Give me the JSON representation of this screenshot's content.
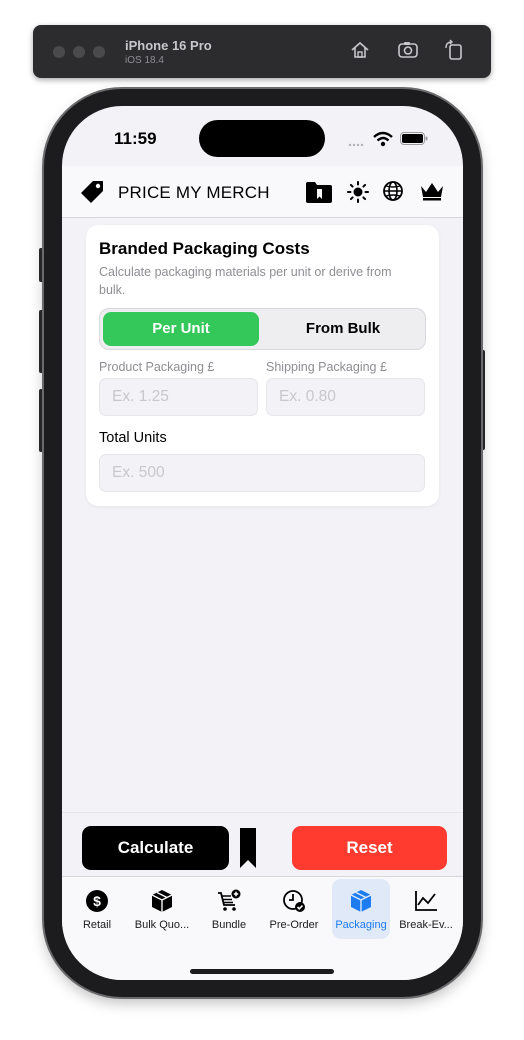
{
  "simulator": {
    "device": "iPhone 16 Pro",
    "os": "iOS 18.4"
  },
  "status_bar": {
    "time": "11:59"
  },
  "header": {
    "title": "PRICE MY MERCH"
  },
  "card": {
    "title": "Branded Packaging Costs",
    "subtitle": "Calculate packaging materials per unit or derive from bulk.",
    "segments": {
      "selected": "Per Unit",
      "other": "From Bulk"
    },
    "product_label": "Product Packaging £",
    "product_placeholder": "Ex. 1.25",
    "shipping_label": "Shipping Packaging £",
    "shipping_placeholder": "Ex. 0.80",
    "units_label": "Total Units",
    "units_placeholder": "Ex. 500"
  },
  "actions": {
    "calculate": "Calculate",
    "reset": "Reset"
  },
  "tabs": [
    {
      "label": "Retail",
      "icon": "dollar-circle-icon"
    },
    {
      "label": "Bulk Quo...",
      "icon": "box-icon"
    },
    {
      "label": "Bundle",
      "icon": "cart-plus-icon"
    },
    {
      "label": "Pre-Order",
      "icon": "clock-check-icon"
    },
    {
      "label": "Packaging",
      "icon": "package-icon"
    },
    {
      "label": "Break-Ev...",
      "icon": "trend-chart-icon"
    }
  ],
  "colors": {
    "accent": "#34c759",
    "reset": "#ff3b30",
    "active_tab": "#1e7cf2"
  }
}
